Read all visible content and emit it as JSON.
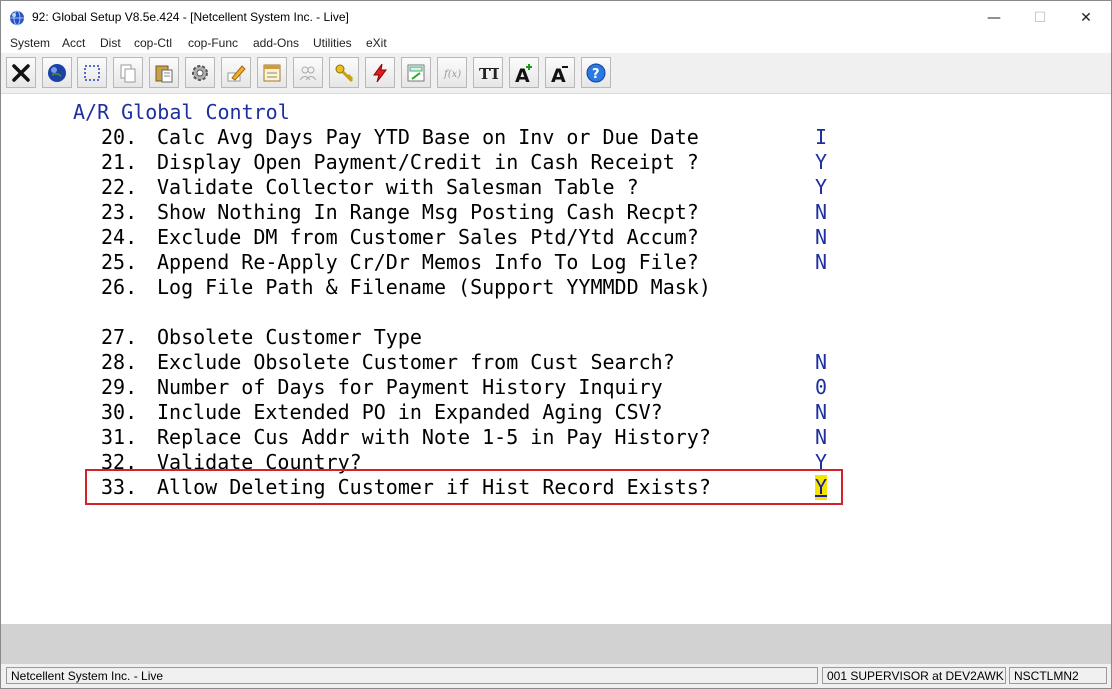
{
  "window": {
    "title": "92: Global Setup V8.5e.424 - [Netcellent System Inc. - Live]",
    "controls": {
      "minimize": "—",
      "maximize": "☐",
      "close": "✕"
    }
  },
  "menu": [
    "System",
    "Acct",
    "Dist",
    "cop-Ctl",
    "cop-Func",
    "add-Ons",
    "Utilities",
    "eXit"
  ],
  "toolbar_icons": [
    "exit-icon",
    "globe-icon",
    "select-icon",
    "copy-icon",
    "paste-icon",
    "settings-icon",
    "edit-icon",
    "form-icon",
    "users-icon",
    "key-icon",
    "lightning-icon",
    "calculator-icon",
    "function-icon",
    "font-type-icon",
    "font-increase-icon",
    "font-decrease-icon",
    "help-icon"
  ],
  "toolbar_glyphs": {
    "font_type": "TT",
    "font_increase": "A",
    "font_decrease": "A",
    "help": "?",
    "function": "f(x)"
  },
  "screen": {
    "title": "A/R Global Control",
    "items": [
      {
        "num": "20.",
        "label": "Calc Avg Days Pay YTD Base on Inv or Due Date",
        "value": "I"
      },
      {
        "num": "21.",
        "label": "Display Open Payment/Credit in Cash Receipt ?",
        "value": "Y"
      },
      {
        "num": "22.",
        "label": "Validate Collector with Salesman Table ?",
        "value": "Y"
      },
      {
        "num": "23.",
        "label": "Show Nothing In Range Msg Posting Cash Recpt?",
        "value": "N"
      },
      {
        "num": "24.",
        "label": "Exclude DM from Customer Sales Ptd/Ytd Accum?",
        "value": "N"
      },
      {
        "num": "25.",
        "label": "Append Re-Apply Cr/Dr Memos Info To Log File?",
        "value": "N"
      },
      {
        "num": "26.",
        "label": "Log File Path & Filename (Support YYMMDD Mask)",
        "value": ""
      },
      {
        "num": "27.",
        "label": "Obsolete Customer Type",
        "value": ""
      },
      {
        "num": "28.",
        "label": "Exclude Obsolete Customer from Cust Search?",
        "value": "N"
      },
      {
        "num": "29.",
        "label": "Number of Days for Payment History Inquiry",
        "value": "0"
      },
      {
        "num": "30.",
        "label": "Include Extended PO in Expanded Aging CSV?",
        "value": "N"
      },
      {
        "num": "31.",
        "label": "Replace Cus Addr with Note 1-5 in Pay History?",
        "value": "N"
      },
      {
        "num": "32.",
        "label": "Validate Country?",
        "value": "Y"
      },
      {
        "num": "33.",
        "label": "Allow Deleting Customer if Hist Record Exists?",
        "value": "Y"
      }
    ]
  },
  "status": {
    "company": "Netcellent System Inc. - Live",
    "user": "001 SUPERVISOR at DEV2AWK",
    "terminal": "NSCTLMN2"
  },
  "colors": {
    "field_value": "#1f2fa0",
    "highlight_border": "#d4222a",
    "cursor_bg": "#f5e600"
  }
}
